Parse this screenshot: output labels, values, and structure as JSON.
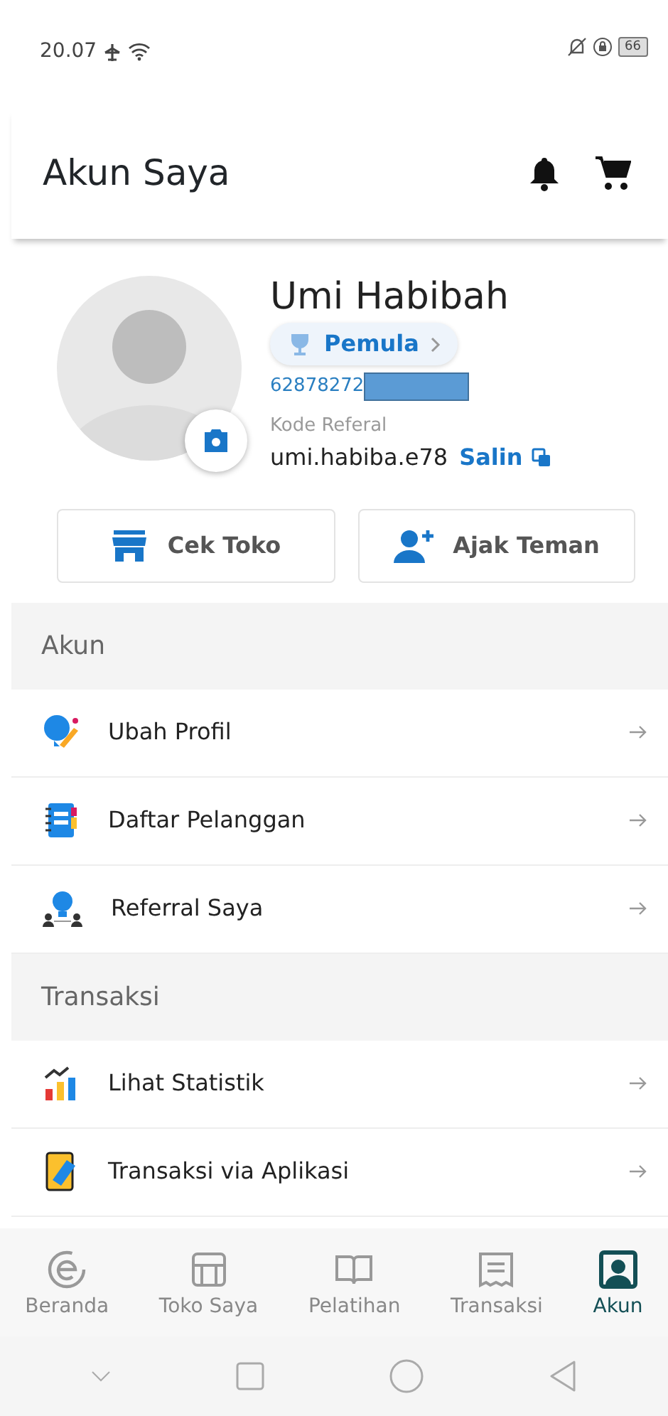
{
  "status_bar": {
    "time": "20.07",
    "battery": "66"
  },
  "header": {
    "title": "Akun Saya"
  },
  "profile": {
    "name": "Umi Habibah",
    "level_badge": "Pemula",
    "phone": "62878272",
    "referral_label": "Kode Referal",
    "referral_code": "umi.habiba.e78",
    "copy_label": "Salin"
  },
  "actions": [
    "Cek Toko",
    "Ajak Teman"
  ],
  "sections": [
    {
      "title": "Akun",
      "items": [
        "Ubah Profil",
        "Daftar Pelanggan",
        "Referral Saya"
      ]
    },
    {
      "title": "Transaksi",
      "items": [
        "Lihat Statistik",
        "Transaksi via Aplikasi"
      ]
    }
  ],
  "bottom_nav": [
    {
      "label": "Beranda",
      "selected": false
    },
    {
      "label": "Toko Saya",
      "selected": false
    },
    {
      "label": "Pelatihan",
      "selected": false
    },
    {
      "label": "Transaksi",
      "selected": false
    },
    {
      "label": "Akun",
      "selected": true
    }
  ]
}
